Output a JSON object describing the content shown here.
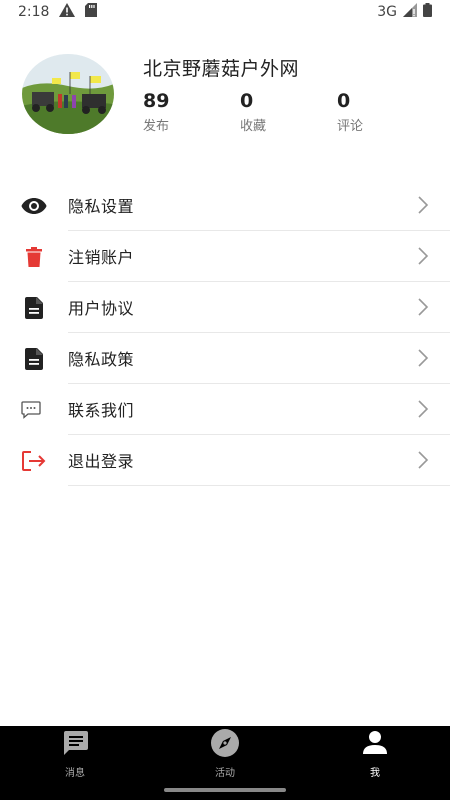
{
  "status_bar": {
    "time": "2:18",
    "network": "3G"
  },
  "profile": {
    "name": "北京野蘑菇户外网",
    "stats": [
      {
        "value": "89",
        "label": "发布"
      },
      {
        "value": "0",
        "label": "收藏"
      },
      {
        "value": "0",
        "label": "评论"
      }
    ]
  },
  "menu": {
    "items": [
      {
        "label": "隐私设置",
        "icon": "eye-icon"
      },
      {
        "label": "注销账户",
        "icon": "trash-icon"
      },
      {
        "label": "用户协议",
        "icon": "document-icon"
      },
      {
        "label": "隐私政策",
        "icon": "document-icon"
      },
      {
        "label": "联系我们",
        "icon": "chat-icon"
      },
      {
        "label": "退出登录",
        "icon": "logout-icon"
      }
    ]
  },
  "tab_bar": {
    "tabs": [
      {
        "label": "消息",
        "icon": "message-icon",
        "active": false
      },
      {
        "label": "活动",
        "icon": "compass-icon",
        "active": false
      },
      {
        "label": "我",
        "icon": "person-icon",
        "active": true
      }
    ]
  },
  "colors": {
    "accent_red": "#e53935",
    "tab_bar_bg": "#000000"
  }
}
